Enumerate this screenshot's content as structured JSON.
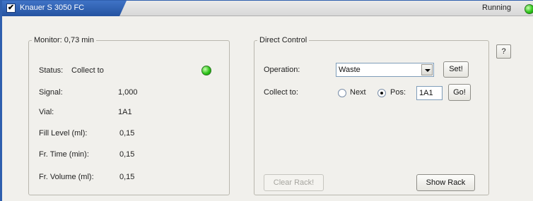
{
  "header": {
    "enabled_checkmark": "✔",
    "title": "Knauer S 3050 FC",
    "run_status": "Running",
    "run_status_color": "#2fc41a"
  },
  "monitor": {
    "legend": "Monitor: 0,73 min",
    "status_label": "Status:",
    "status_value": "Collect to",
    "status_led_color": "#2fc41a",
    "rows": [
      {
        "label": "Signal:",
        "value": "1,000"
      },
      {
        "label": "Vial:",
        "value": "1A1"
      },
      {
        "label": "Fill Level (ml):",
        "value": "0,15"
      },
      {
        "label": "Fr. Time (min):",
        "value": "0,15"
      },
      {
        "label": "Fr. Volume (ml):",
        "value": "0,15"
      }
    ]
  },
  "help_button": {
    "label": "?"
  },
  "direct_control": {
    "legend": "Direct Control",
    "operation_label": "Operation:",
    "operation_value": "Waste",
    "set_button": "Set!",
    "collect_label": "Collect to:",
    "radio_next": {
      "label": "Next",
      "checked": false
    },
    "radio_pos": {
      "label": "Pos:",
      "checked": true
    },
    "pos_value": "1A1",
    "go_button": "Go!",
    "clear_rack_button": "Clear Rack!",
    "clear_rack_enabled": false,
    "show_rack_button": "Show Rack"
  }
}
